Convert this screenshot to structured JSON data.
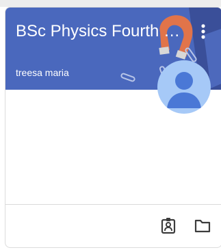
{
  "class_card": {
    "title": "BSc Physics Fourth S...",
    "owner": "treesa maria",
    "banner_color": "#4a68bd",
    "avatar_color": "#a6c9f7",
    "avatar_icon": "person-icon",
    "menu_icon": "more-vert-icon",
    "actions": [
      {
        "icon": "assignment-ind-icon"
      },
      {
        "icon": "folder-icon"
      }
    ]
  }
}
